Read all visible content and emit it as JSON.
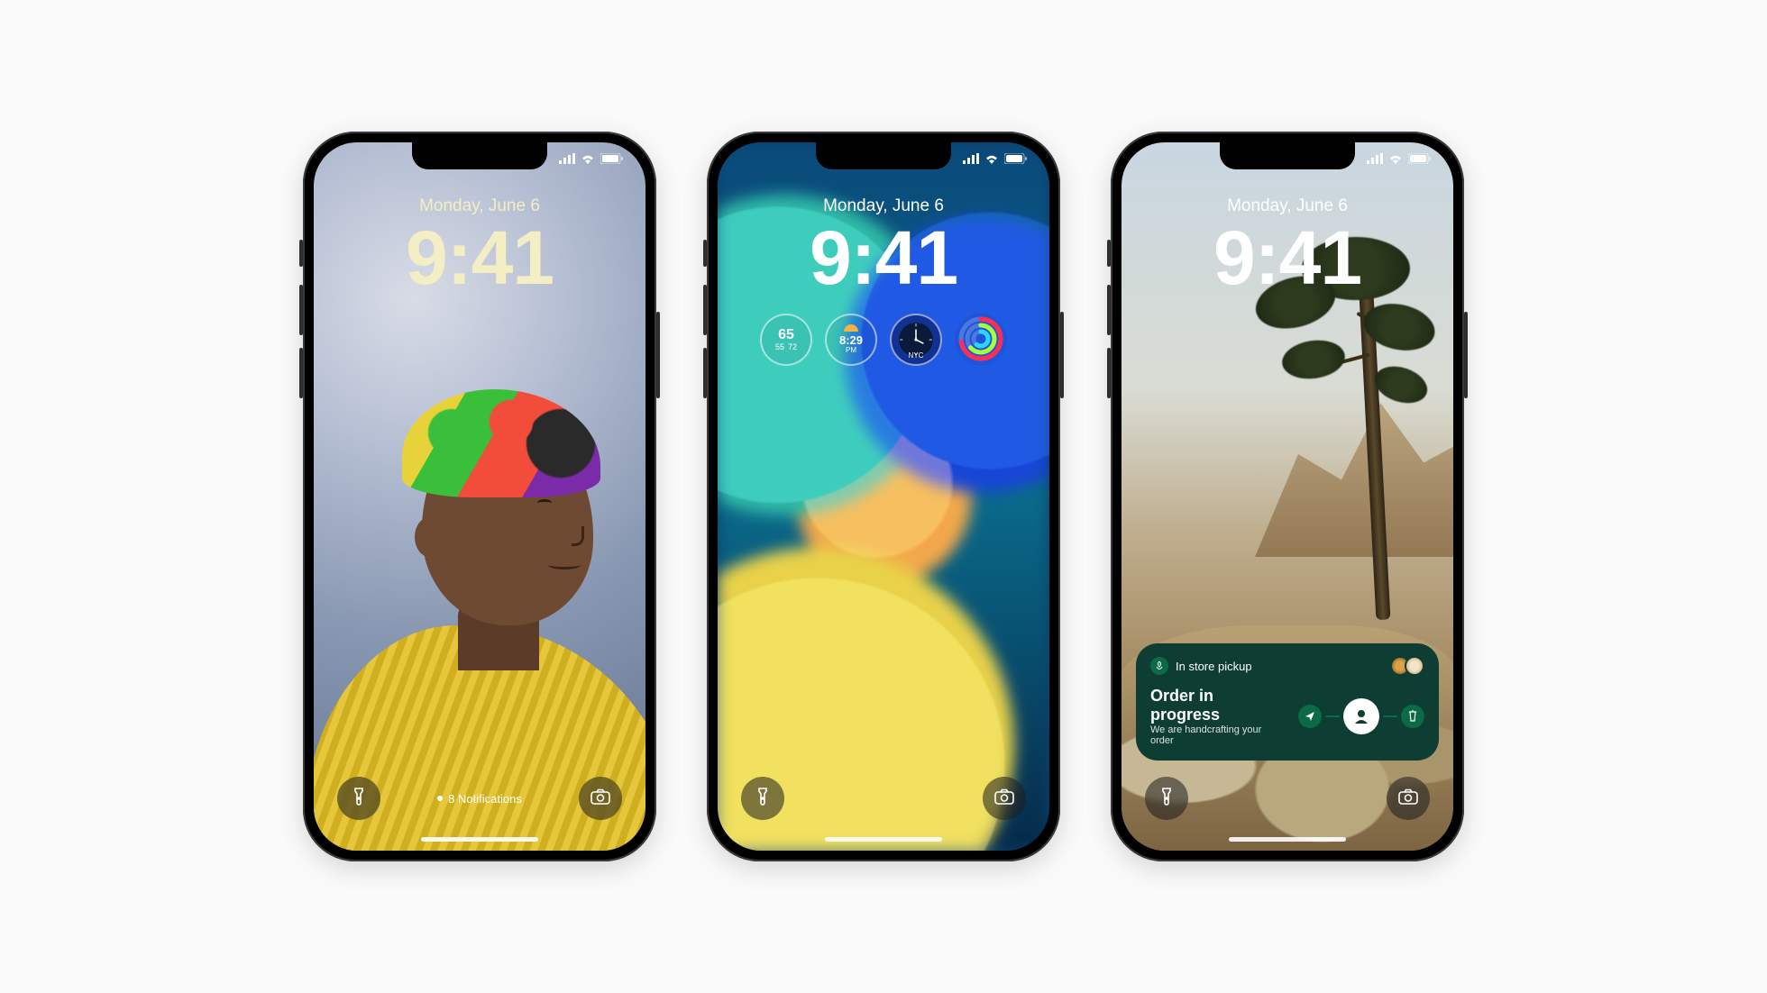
{
  "status": {
    "cellular": "signal-bars",
    "wifi": "wifi",
    "battery": "battery-full"
  },
  "date": "Monday, June 6",
  "time": "9:41",
  "phone1": {
    "notifications_label": "8 Notifications"
  },
  "phone2": {
    "widgets": {
      "weather": {
        "temp": "65",
        "low": "55",
        "high": "72"
      },
      "sun": {
        "time": "8:29",
        "period": "PM"
      },
      "world_clock": {
        "city": "NYC"
      },
      "activity": "rings"
    }
  },
  "phone3": {
    "live_activity": {
      "app": "Starbucks",
      "header": "In store pickup",
      "title": "Order in progress",
      "subtitle": "We are handcrafting your order",
      "steps": [
        "sent",
        "preparing",
        "ready"
      ]
    }
  },
  "icons": {
    "flashlight": "flashlight-icon",
    "camera": "camera-icon"
  }
}
